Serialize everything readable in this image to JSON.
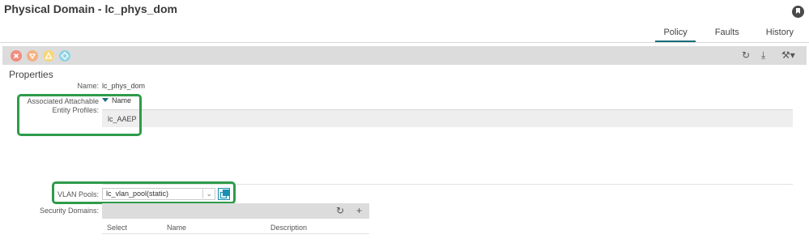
{
  "page": {
    "title": "Physical Domain - lc_phys_dom"
  },
  "tabs": [
    {
      "label": "Policy",
      "active": true
    },
    {
      "label": "Faults",
      "active": false
    },
    {
      "label": "History",
      "active": false
    }
  ],
  "toolbar": {
    "status_icons": [
      "critical-fault-icon",
      "major-fault-icon",
      "minor-fault-icon",
      "warning-fault-icon"
    ],
    "status_colors": [
      "#f08c7f",
      "#f4b183",
      "#f7d67a",
      "#8fd3e6"
    ],
    "actions": {
      "refresh": "↻",
      "download": "⤓",
      "tools": "⚒▾"
    }
  },
  "properties": {
    "section_title": "Properties",
    "name_label": "Name:",
    "name_value": "lc_phys_dom",
    "aep_label_line1": "Associated Attachable",
    "aep_label_line2": "Entity Profiles:",
    "aep_column": "Name",
    "aep_rows": [
      "lc_AAEP"
    ],
    "vlan_label": "VLAN Pools:",
    "vlan_value": "lc_vlan_pool(static)",
    "security_label": "Security Domains:",
    "security_actions": {
      "refresh": "↻",
      "add": "+"
    },
    "security_columns": [
      "Select",
      "Name",
      "Description"
    ]
  },
  "colors": {
    "highlight": "#2e9b4a",
    "accent": "#1a6e7a"
  }
}
